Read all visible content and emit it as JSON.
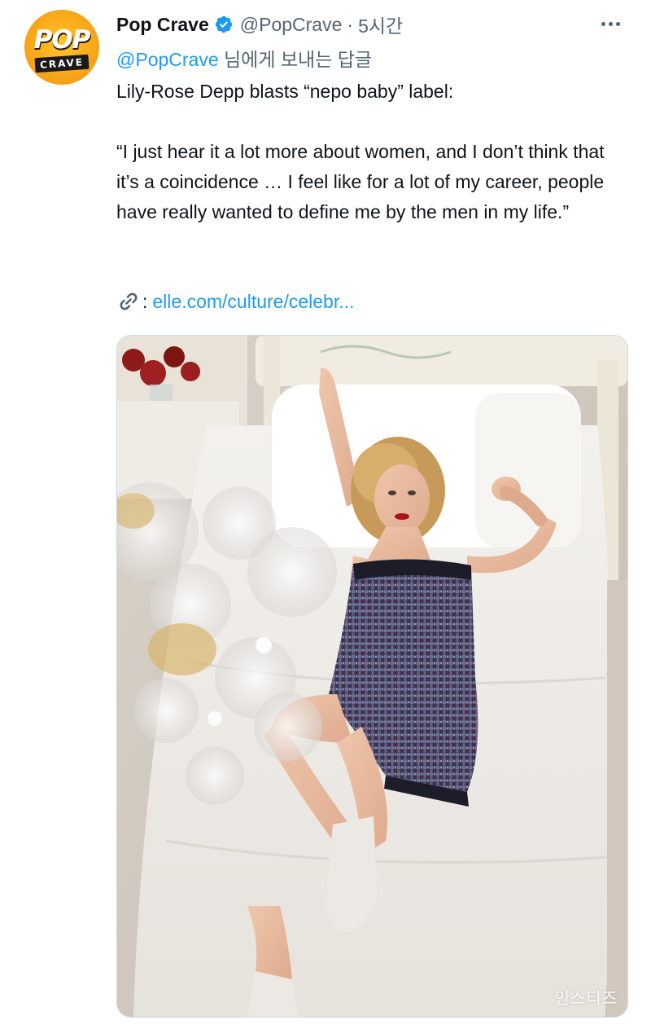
{
  "tweet": {
    "author": {
      "name": "Pop Crave",
      "handle": "@PopCrave",
      "logo_line1": "POP",
      "logo_line2": "CRAVE"
    },
    "separator": "·",
    "time": "5시간",
    "reply_to": {
      "mention": "@PopCrave",
      "suffix": " 님에게 보내는 답글"
    },
    "body": {
      "line1": "Lily-Rose Depp blasts “nepo baby” label:",
      "quote": "“I just hear it a lot more about women, and I don’t think that it’s a coincidence … I feel like for a lot of my career, people have really wanted to define me by the men in my life.”"
    },
    "link": {
      "colon": ":",
      "url": "elle.com/culture/celebr..."
    },
    "media": {
      "watermark": "인스티즈"
    }
  },
  "colors": {
    "link": "#1d9bf0",
    "secondary_text": "#536471",
    "verified": "#1d9bf0"
  },
  "icons": [
    "verified-badge-icon",
    "more-options-icon",
    "link-icon"
  ]
}
